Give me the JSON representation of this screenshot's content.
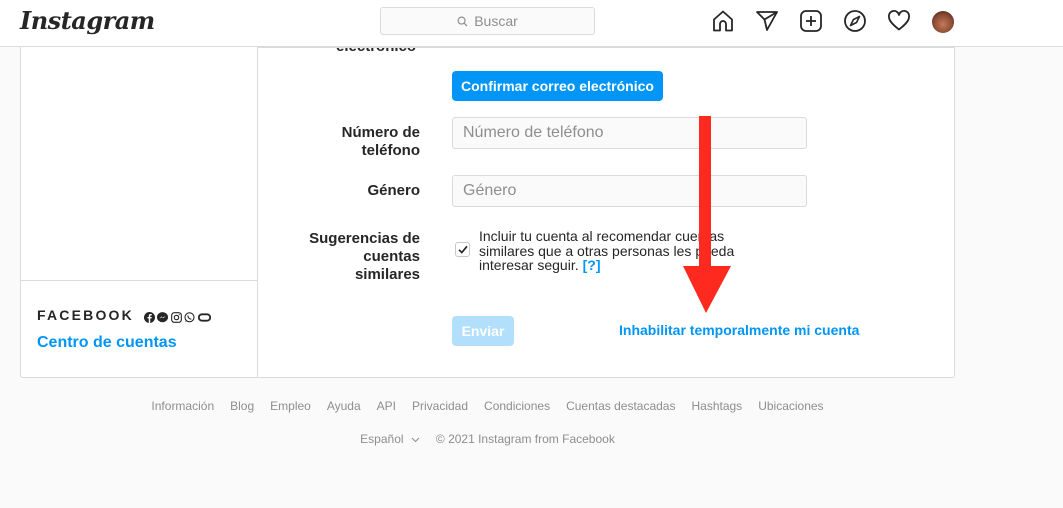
{
  "app": {
    "logo": "Instagram"
  },
  "header": {
    "search_placeholder": "Buscar",
    "nav_icons": [
      "home-icon",
      "direct-icon",
      "new-post-icon",
      "explore-icon",
      "activity-icon",
      "profile-avatar"
    ]
  },
  "sidebar": {
    "facebook_label": "FACEBOOK",
    "facebook_icons": [
      "facebook-icon",
      "messenger-icon",
      "instagram-icon",
      "whatsapp-icon",
      "oculus-icon"
    ],
    "accounts_center": "Centro de cuentas"
  },
  "form": {
    "email_label_partial": "electrónico",
    "confirm_email_button": "Confirmar correo electrónico",
    "phone_label_line1": "Número de",
    "phone_label_line2": "teléfono",
    "phone_placeholder": "Número de teléfono",
    "phone_value": "",
    "gender_label": "Género",
    "gender_placeholder": "Género",
    "gender_value": "",
    "suggestions_label_line1": "Sugerencias de",
    "suggestions_label_line2": "cuentas",
    "suggestions_label_line3": "similares",
    "suggestions_checked": true,
    "suggestions_text": "Incluir tu cuenta al recomendar cuentas similares que a otras personas les pueda interesar seguir.",
    "suggestions_help": "[?]",
    "submit_button": "Enviar",
    "disable_account_link": "Inhabilitar temporalmente mi cuenta"
  },
  "annotation": {
    "arrow_color": "#ff2a1f"
  },
  "colors": {
    "accent": "#0095f6",
    "accent_disabled": "#b2dffc",
    "border": "#dbdbdb"
  },
  "footer": {
    "links": [
      "Información",
      "Blog",
      "Empleo",
      "Ayuda",
      "API",
      "Privacidad",
      "Condiciones",
      "Cuentas destacadas",
      "Hashtags",
      "Ubicaciones"
    ],
    "language": "Español",
    "copyright": "© 2021 Instagram from Facebook"
  }
}
